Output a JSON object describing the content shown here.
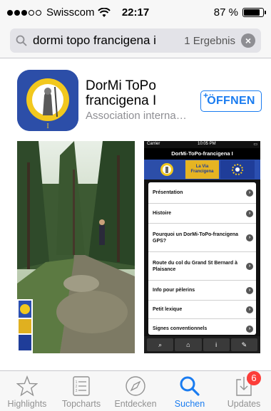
{
  "status_bar": {
    "carrier": "Swisscom",
    "signal_bars": 3,
    "signal_total": 5,
    "time": "22:17",
    "battery_percent_label": "87 %",
    "battery_level": 0.87
  },
  "search": {
    "query": "dormi topo francigena i",
    "result_count": "1 Ergebnis",
    "clear_icon": "clear-x-icon"
  },
  "app": {
    "name": "DorMi ToPo francigena I",
    "developer": "Association interna…",
    "open_button": "ÖFFNEN",
    "open_button_plus": "+",
    "accent_color": "#1a7cf0"
  },
  "screenshot_2": {
    "carrier": "Carrier",
    "time": "10:05 PM",
    "title": "DorMi-ToPo-francigena I",
    "banner_text": "La Via Francigena",
    "menu_items": [
      "Présentation",
      "Histoire",
      "Pourquoi un DorMi-ToPo-francigena GPS?",
      "Route du col du Grand St Bernard à Plaisance",
      "Info pour pèlerins",
      "Petit lexique",
      "Signes conventionnels"
    ],
    "tab_icons": [
      "search-icon",
      "home-icon",
      "info-icon",
      "tools-icon"
    ]
  },
  "tab_bar": {
    "items": [
      {
        "label": "Highlights",
        "icon": "star-icon"
      },
      {
        "label": "Topcharts",
        "icon": "list-icon"
      },
      {
        "label": "Entdecken",
        "icon": "compass-icon"
      },
      {
        "label": "Suchen",
        "icon": "search-icon"
      },
      {
        "label": "Updates",
        "icon": "download-icon"
      }
    ],
    "active": "Suchen",
    "updates_badge": "6",
    "active_color": "#1a7cf0",
    "badge_color": "#fc3d39"
  }
}
